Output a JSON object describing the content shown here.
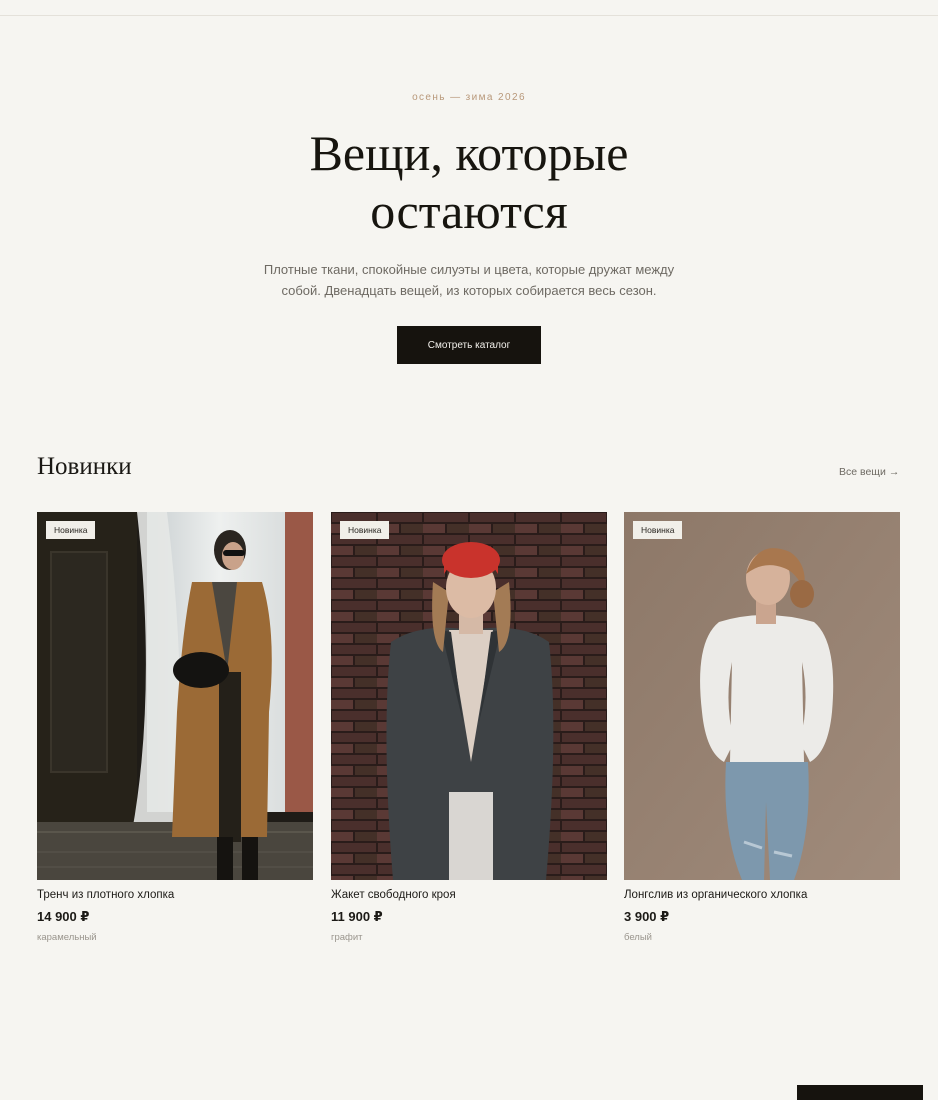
{
  "hero": {
    "eyebrow": "осень — зима 2026",
    "title_line1": "Вещи, которые",
    "title_line2": "остаются",
    "subtitle": "Плотные ткани, спокойные силуэты и цвета, которые дружат между собой. Двенадцать вещей, из которых собирается весь сезон.",
    "cta_label": "Смотреть каталог"
  },
  "new_section": {
    "title": "Новинки",
    "all_link": "Все вещи",
    "all_link_icon": "arrow-right-icon"
  },
  "products": [
    {
      "badge": "Новинка",
      "name": "Тренч из плотного хлопка",
      "price": "14 900 ₽",
      "color": "карамельный"
    },
    {
      "badge": "Новинка",
      "name": "Жакет свободного кроя",
      "price": "11 900 ₽",
      "color": "графит"
    },
    {
      "badge": "Новинка",
      "name": "Лонгслив из органического хлопка",
      "price": "3 900 ₽",
      "color": "белый"
    }
  ],
  "palette": {
    "background": "#f6f5f1",
    "accent": "#b8987a",
    "button": "#16130e"
  }
}
